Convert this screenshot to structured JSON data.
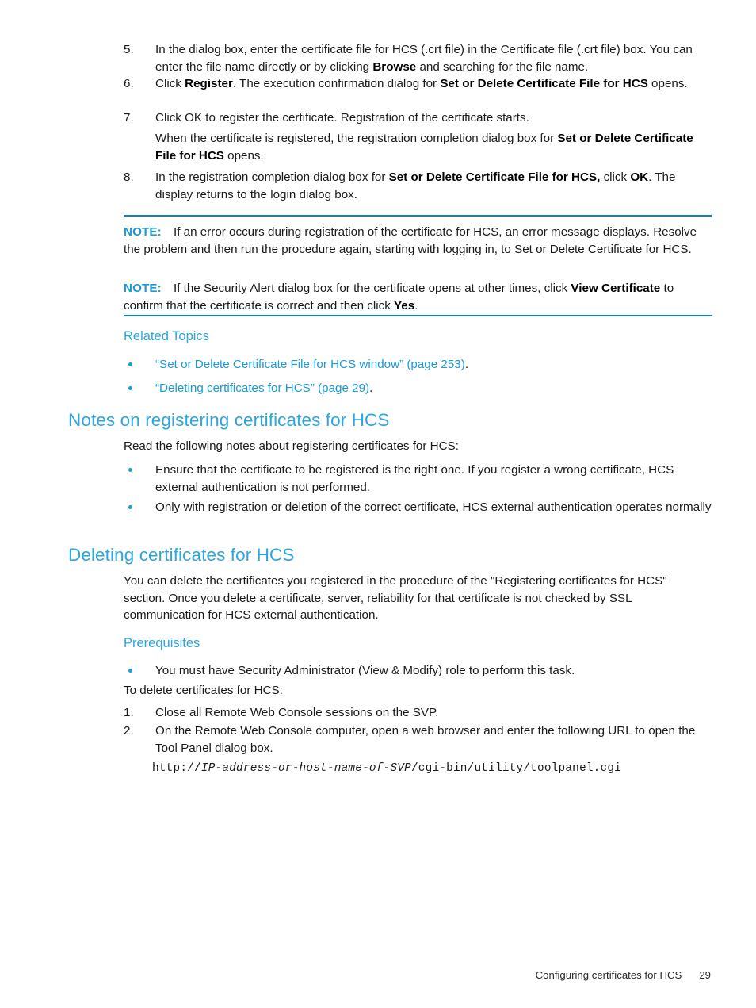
{
  "document": {
    "steps_top": [
      {
        "number": "5.",
        "lines": [
          [
            {
              "t": "In the dialog box, enter the certificate file for HCS (.crt file) in the Certificate file (.crt file) box. You can enter the file name directly or by clicking ",
              "b": false
            },
            {
              "t": "Browse",
              "b": true
            },
            {
              "t": " and searching for the file name.",
              "b": false
            }
          ]
        ]
      },
      {
        "number": "6.",
        "lines": [
          [
            {
              "t": "Click ",
              "b": false
            },
            {
              "t": "Register",
              "b": true
            },
            {
              "t": ". The execution confirmation dialog for ",
              "b": false
            },
            {
              "t": "Set or Delete Certificate File for HCS",
              "b": true
            },
            {
              "t": " opens.",
              "b": false
            }
          ]
        ]
      },
      {
        "number": "7.",
        "lines": [
          [
            {
              "t": "Click OK to register the certificate. Registration of the certificate starts.",
              "b": false
            }
          ]
        ],
        "continuation": [
          {
            "t": "When the certificate is registered, the registration completion dialog box for ",
            "b": false
          },
          {
            "t": "Set or Delete Certificate File for HCS",
            "b": true
          },
          {
            "t": " opens.",
            "b": false
          }
        ]
      },
      {
        "number": "8.",
        "lines": [
          [
            {
              "t": "In the registration completion dialog box for ",
              "b": false
            },
            {
              "t": "Set or Delete Certificate File for HCS,",
              "b": true
            },
            {
              "t": " click ",
              "b": false
            },
            {
              "t": "OK",
              "b": true
            },
            {
              "t": ". The display returns to the login dialog box.",
              "b": false
            }
          ]
        ]
      }
    ],
    "notes": [
      {
        "label": "NOTE:",
        "runs": [
          {
            "t": "If an error occurs during registration of the certificate for HCS, an error message displays. Resolve the problem and then run the procedure again, starting with logging in, to Set or Delete Certificate for HCS.",
            "b": false
          }
        ]
      },
      {
        "label": "NOTE:",
        "runs": [
          {
            "t": "If the Security Alert dialog box for the certificate opens at other times, click ",
            "b": false
          },
          {
            "t": "View Certificate",
            "b": true
          },
          {
            "t": " to confirm that the certificate is correct and then click ",
            "b": false
          },
          {
            "t": "Yes",
            "b": true
          },
          {
            "t": ".",
            "b": false
          }
        ]
      }
    ],
    "related_topics": {
      "heading": "Related Topics",
      "links": [
        {
          "link": "“Set or Delete Certificate File for HCS window” (page 253)",
          "tail": "."
        },
        {
          "link": "“Deleting certificates for HCS” (page 29)",
          "tail": "."
        }
      ]
    },
    "section_notes_registering": {
      "heading": "Notes on registering certificates for HCS",
      "intro": "Read the following notes about registering certificates for HCS:",
      "bullets": [
        "Ensure that the certificate to be registered is the right one. If you register a wrong certificate, HCS external authentication is not performed.",
        "Only with registration or deletion of the correct certificate, HCS external authentication operates normally"
      ]
    },
    "section_deleting": {
      "heading": "Deleting certificates for HCS",
      "paragraph": "You can delete the certificates you registered in the procedure of the \"Registering certificates for HCS\" section. Once you delete a certificate, server, reliability for that certificate is not checked by SSL communication for HCS external authentication.",
      "prerequisites_heading": "Prerequisites",
      "prerequisites_bullets": [
        "You must have Security Administrator (View & Modify) role to perform this task."
      ],
      "lead_in": "To delete certificates for HCS:",
      "steps": [
        {
          "number": "1.",
          "text": "Close all Remote Web Console sessions on the SVP."
        },
        {
          "number": "2.",
          "text": "On the Remote Web Console computer, open a web browser and enter the following URL to open the Tool Panel dialog box."
        }
      ],
      "url": {
        "prefix": "http://",
        "variable": "IP-address-or-host-name-of-SVP",
        "suffix": "/cgi-bin/utility/toolpanel.cgi"
      }
    },
    "footer": {
      "title": "Configuring certificates for HCS",
      "page_number": "29"
    },
    "colors": {
      "heading_blue": "#2ba6df",
      "accent_blue": "#1b9ad6",
      "rule_blue": "#0f83c0",
      "text": "#1a1a1a"
    }
  }
}
